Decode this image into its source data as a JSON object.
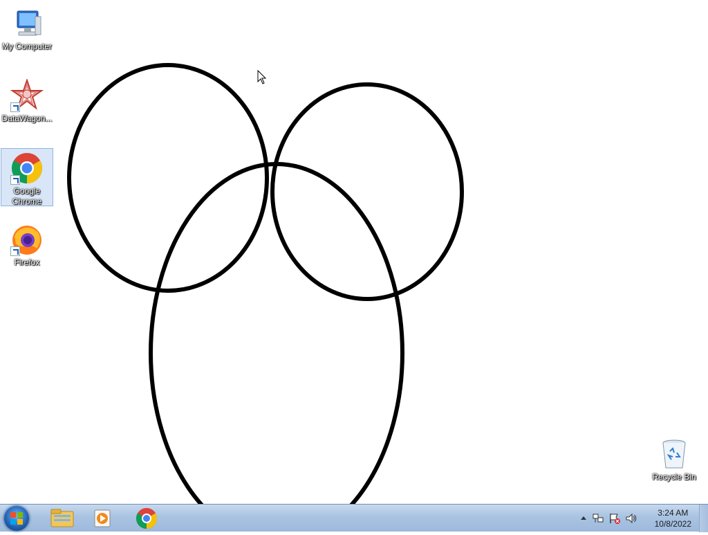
{
  "desktop": {
    "icons": [
      {
        "label": "My Computer",
        "icon": "my-computer-icon"
      },
      {
        "label": "DataWagon...",
        "icon": "datawagon-icon"
      },
      {
        "label": "Google Chrome",
        "icon": "chrome-icon"
      },
      {
        "label": "Firefox",
        "icon": "firefox-icon"
      },
      {
        "label": "Recycle Bin",
        "icon": "recycle-bin-icon"
      }
    ]
  },
  "taskbar": {
    "pinned": [
      "windows-explorer-icon",
      "media-player-icon",
      "chrome-icon"
    ],
    "clock": {
      "time": "3:24 AM",
      "date": "10/8/2022"
    }
  },
  "colors": {
    "taskbar_top": "#c7d9ee",
    "taskbar_bottom": "#9db9dc",
    "drawing_stroke": "#000000"
  }
}
